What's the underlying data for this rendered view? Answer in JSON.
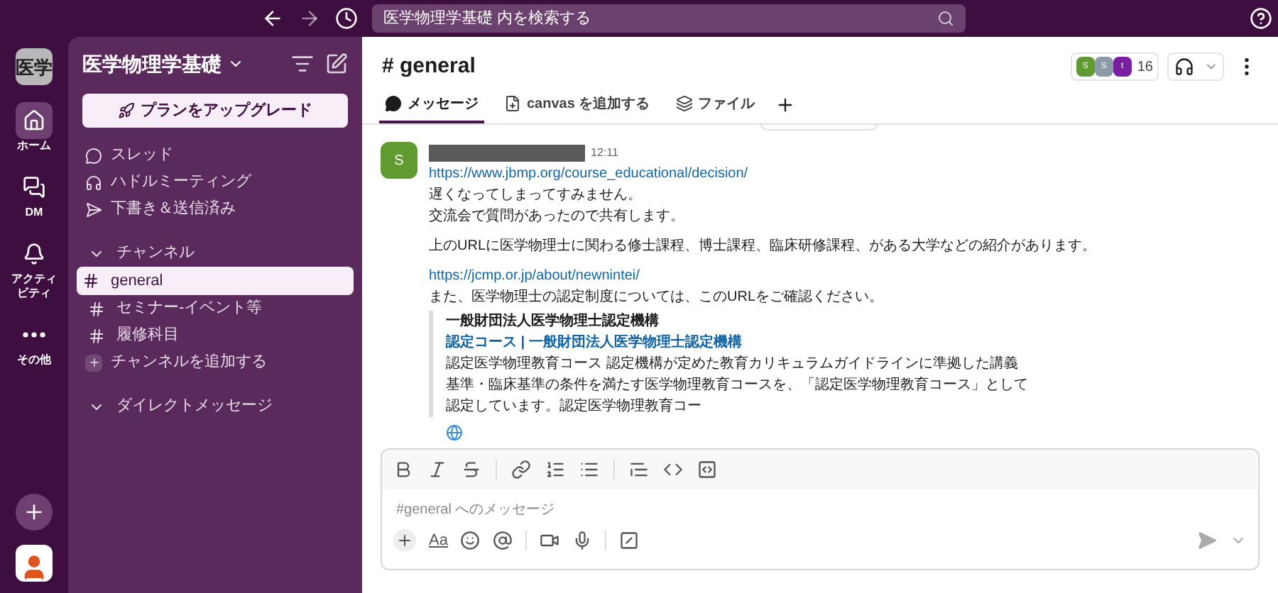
{
  "top_bar": {
    "search_placeholder": "医学物理学基礎 内を検索する"
  },
  "rail": {
    "workspace_icon": "医学",
    "items": [
      {
        "kind": "home",
        "label": "ホーム",
        "selected": true
      },
      {
        "kind": "dm",
        "label": "DM",
        "selected": false
      },
      {
        "kind": "activity",
        "label": "アクティビティ",
        "selected": false
      },
      {
        "kind": "more",
        "label": "その他",
        "selected": false
      }
    ]
  },
  "sidebar": {
    "workspace": "医学物理学基礎",
    "upgrade_button": "プランをアップグレード",
    "nav": [
      {
        "kind": "threads",
        "label": "スレッド"
      },
      {
        "kind": "huddles",
        "label": "ハドルミーティング"
      },
      {
        "kind": "drafts",
        "label": "下書き＆送信済み"
      }
    ],
    "sections": [
      {
        "title": "チャンネル",
        "expanded": true,
        "channels": [
          {
            "name": "general",
            "selected": true
          },
          {
            "name": "セミナー-イベント等",
            "selected": false
          },
          {
            "name": "履修科目",
            "selected": false
          }
        ],
        "add_label": "チャンネルを追加する"
      },
      {
        "title": "ダイレクトメッセージ",
        "expanded": true
      }
    ]
  },
  "channel": {
    "title": "# general",
    "members": [
      {
        "initial": "S",
        "color": "#5f9b30"
      },
      {
        "initial": "S",
        "color": "#8a9aa6"
      },
      {
        "initial": "t",
        "color": "#7a1fa2"
      }
    ],
    "member_count": "16",
    "tabs": [
      {
        "kind": "messages",
        "label": "メッセージ",
        "selected": true
      },
      {
        "kind": "canvas",
        "label": "canvas を追加する",
        "selected": false
      },
      {
        "kind": "files",
        "label": "ファイル",
        "selected": false
      }
    ]
  },
  "message": {
    "avatar": "S",
    "time": "12:11",
    "paragraphs": [
      [
        {
          "kind": "link",
          "text": "https://www.jbmp.org/course_educational/decision/"
        },
        {
          "kind": "text",
          "text": "遅くなってしまってすみません。"
        },
        {
          "kind": "text",
          "text": "交流会で質問があったので共有します。"
        }
      ],
      [
        {
          "kind": "text",
          "text": "上のURLに医学物理士に関わる修士課程、博士課程、臨床研修課程、がある大学などの紹介があります。"
        }
      ],
      [
        {
          "kind": "link",
          "text": "https://jcmp.or.jp/about/newnintei/"
        },
        {
          "kind": "text",
          "text": "また、医学物理士の認定制度については、このURLをご確認ください。"
        }
      ]
    ],
    "attachment": {
      "site": "一般財団法人医学物理士認定機構",
      "title": "認定コース | 一般財団法人医学物理士認定機構",
      "description_lines": [
        "認定医学物理教育コース 認定機構が定めた教育カリキュラムガイドラインに準拠した講義",
        "基準・臨床基準の条件を満たす医学物理教育コースを、「認定医学物理教育コース」として",
        "認定しています。認定医学物理教育コー"
      ]
    }
  },
  "composer": {
    "placeholder": "#general へのメッセージ",
    "format_label": "Aa"
  }
}
